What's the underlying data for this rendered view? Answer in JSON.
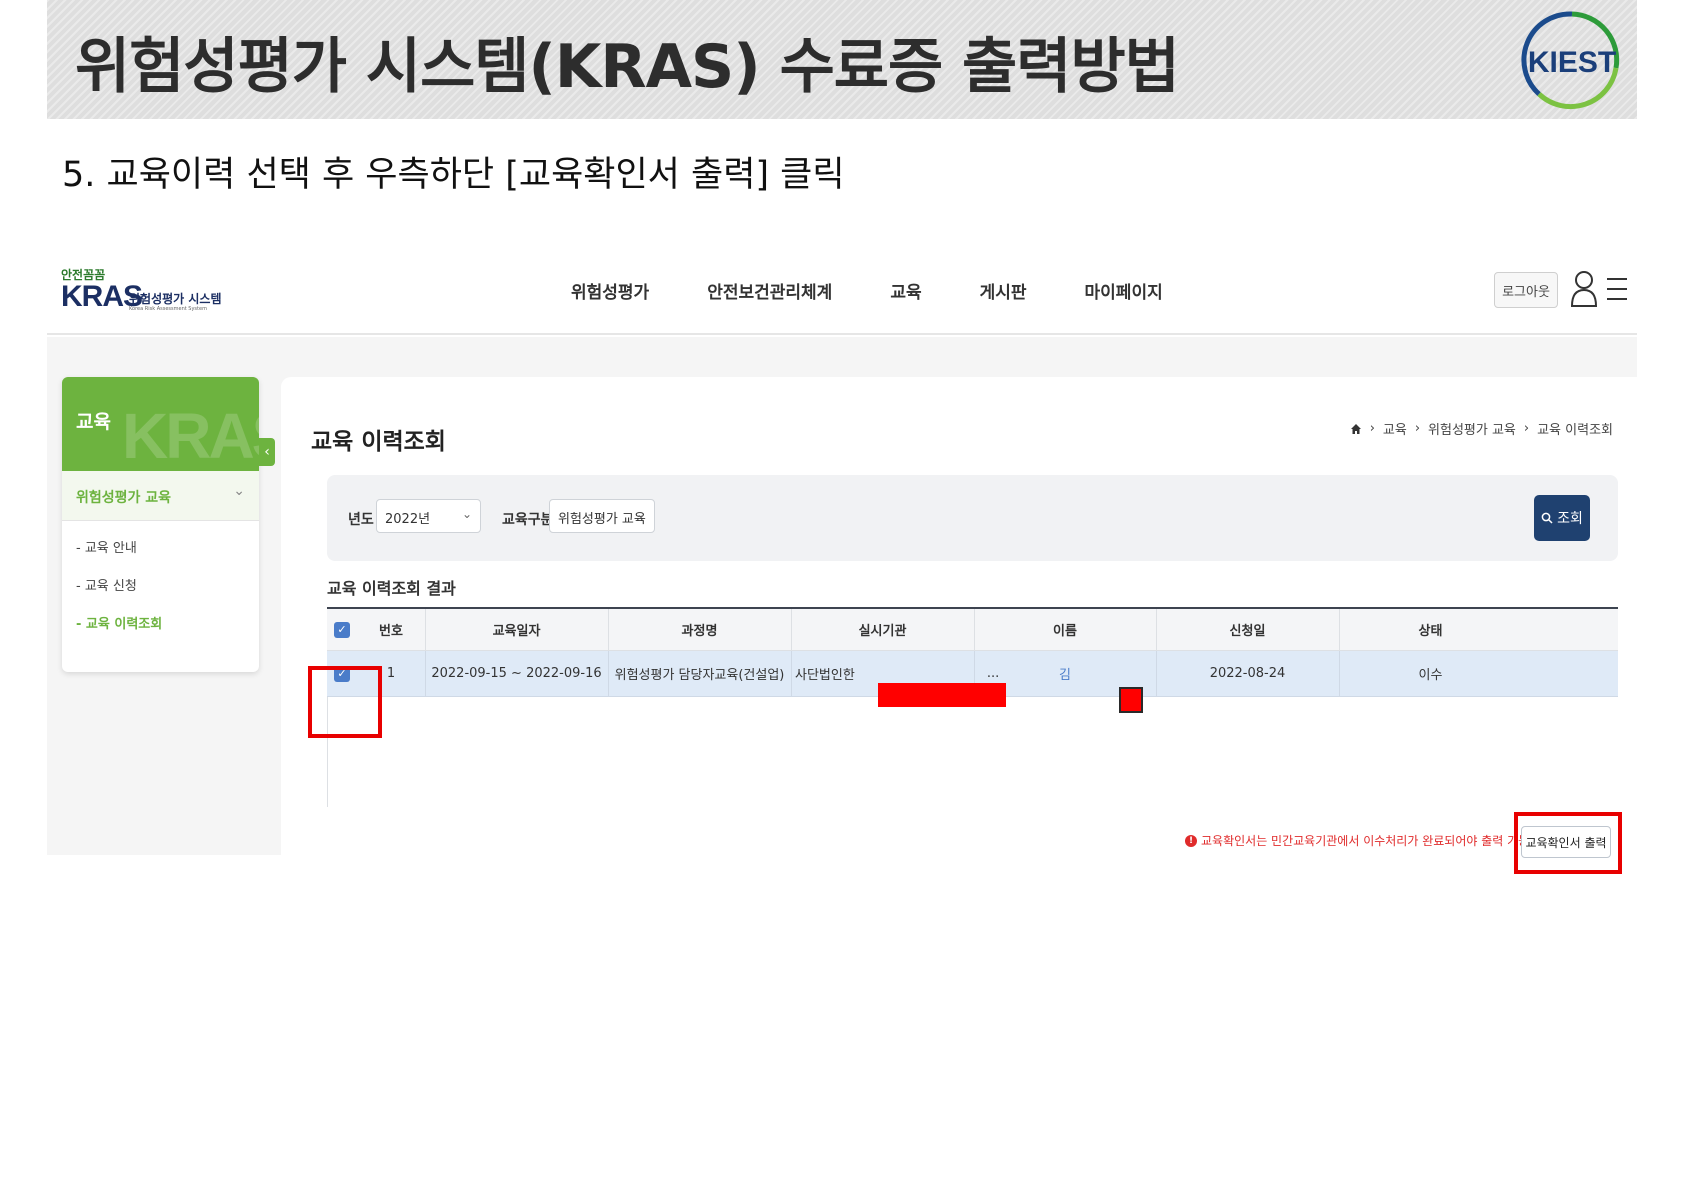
{
  "slide": {
    "title": "위험성평가 시스템(KRAS) 수료증 출력방법",
    "logo_text": "KIEST",
    "step": "5. 교육이력 선택 후 우측하단 [교육확인서 출력] 클릭"
  },
  "site": {
    "brand_small": "안전꼼꼼",
    "brand_main": "KRAS",
    "brand_sub": "위험성평가 시스템",
    "brand_tiny": "Korea Risk Assessment System",
    "nav": [
      "위험성평가",
      "안전보건관리체계",
      "교육",
      "게시판",
      "마이페이지"
    ],
    "logout": "로그아웃"
  },
  "sidebar": {
    "title": "교육",
    "watermark": "KRAS",
    "group": "위험성평가 교육",
    "links": [
      "- 교육 안내",
      "- 교육 신청",
      "- 교육 이력조회"
    ],
    "active_index": 2
  },
  "content": {
    "title": "교육 이력조회",
    "breadcrumb": [
      "교육",
      "위험성평가 교육",
      "교육 이력조회"
    ],
    "filter": {
      "year_label": "년도",
      "year_value": "2022년",
      "type_label": "교육구분",
      "type_value": "위험성평가 교육",
      "search_button": "조회"
    },
    "result_title": "교육 이력조회 결과",
    "table": {
      "headers": [
        "번호",
        "교육일자",
        "과정명",
        "실시기관",
        "이름",
        "신청일",
        "상태"
      ],
      "rows": [
        {
          "checked": true,
          "no": "1",
          "date": "2022-09-15 ~ 2022-09-16",
          "course": "위험성평가 담당자교육(건설업)",
          "org": "사단법인한",
          "org_tail": "...",
          "name": "김",
          "applied": "2022-08-24",
          "status": "이수"
        }
      ]
    },
    "notice": "교육확인서는 민간교육기관에서 이수처리가 완료되어야 출력 가능하십니다.",
    "print_button": "교육확인서 출력"
  },
  "colors": {
    "highlight": "#e80000",
    "brand_green": "#6db33f",
    "navy": "#1f4170",
    "selected_row": "#dfeaf7"
  }
}
